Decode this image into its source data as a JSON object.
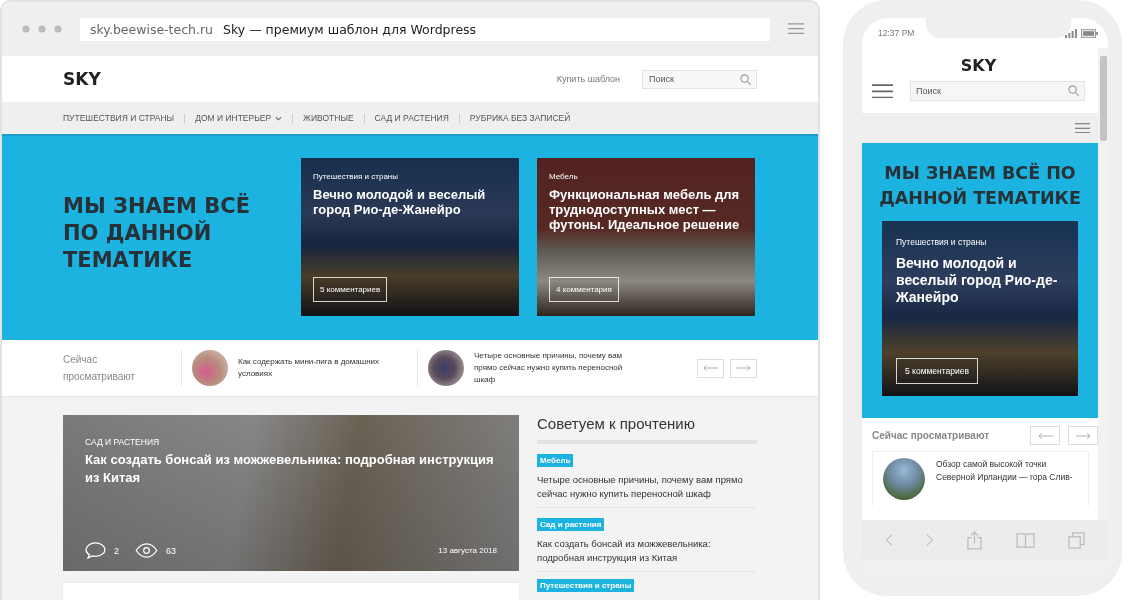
{
  "browser": {
    "address": "sky.beewise-tech.ru",
    "title": "Sky — премиум шаблон для Wordpress"
  },
  "site": {
    "logo": "SKY",
    "buy_link": "Купить шаблон",
    "search": {
      "placeholder": "Поиск"
    },
    "nav": [
      {
        "label": "ПУТЕШЕСТВИЯ И СТРАНЫ",
        "dropdown": false
      },
      {
        "label": "ДОМ И ИНТЕРЬЕР",
        "dropdown": true
      },
      {
        "label": "ЖИВОТНЫЕ",
        "dropdown": false
      },
      {
        "label": "САД И РАСТЕНИЯ",
        "dropdown": false
      },
      {
        "label": "РУБРИКА БЕЗ ЗАПИСЕЙ",
        "dropdown": false
      }
    ],
    "hero": {
      "heading": "МЫ ЗНАЕМ ВСЁ ПО ДАННОЙ ТЕМАТИКЕ",
      "cards": [
        {
          "kind": "city",
          "category": "Путешествия и страны",
          "title": "Вечно молодой и веселый город Рио-де-Жанейро",
          "comments": "5 комментариев"
        },
        {
          "kind": "room",
          "category": "Мебель",
          "title": "Функциональная мебель для труднодоступных мест — футоны. Идеальное решение",
          "comments": "4 комментария"
        }
      ]
    },
    "now_viewing": {
      "label": "Сейчас просматривают",
      "items": [
        {
          "kind": "pink",
          "title": "Как содержать мини-пига в домашних условиях"
        },
        {
          "kind": "navy",
          "title": "Четыре основные причины, почему вам прямо сейчас нужно купить переносной шкаф"
        }
      ]
    },
    "featured": {
      "category": "САД И РАСТЕНИЯ",
      "title": "Как создать бонсай из можжевельника: подробная инструкция из Китая",
      "comments": "2",
      "views": "63",
      "date": "13 августа 2018"
    },
    "recommended": {
      "heading": "Советуем к прочтению",
      "items": [
        {
          "tag": "Мебель",
          "title": "Четыре основные причины, почему вам прямо сейчас нужно купить переносной шкаф"
        },
        {
          "tag": "Сад и растения",
          "title": "Как создать бонсай из можжевельника: подробная инструкция из Китая"
        },
        {
          "tag": "Путешествия и страны"
        }
      ]
    }
  },
  "phone": {
    "time": "12:37 PM",
    "logo": "SKY",
    "search": {
      "placeholder": "Поиск"
    },
    "hero_heading": "МЫ ЗНАЕМ ВСЁ ПО ДАННОЙ ТЕМАТИКЕ",
    "card": {
      "category": "Путешествия и страны",
      "title": "Вечно молодой и веселый город Рио-де-Жанейро",
      "comments": "5 комментариев"
    },
    "now_viewing": {
      "label": "Сейчас просматривают",
      "item": "Обзор самой высокой точки Северной Ирландии — гора Слив-"
    }
  }
}
